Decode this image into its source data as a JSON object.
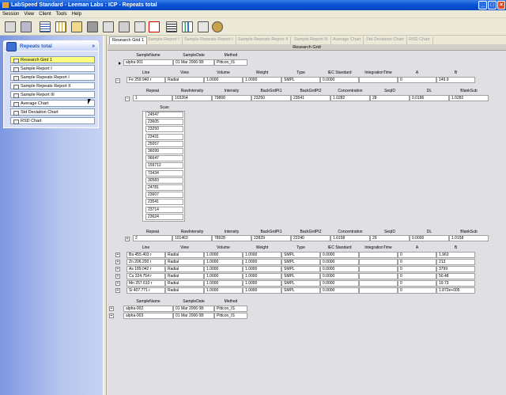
{
  "window": {
    "title": "LabSpeed Standard - Leeman Labs : ICP - Repeats total",
    "min": "_",
    "max": "□",
    "close": "×"
  },
  "menu": [
    "Session",
    "View",
    "Client",
    "Tools",
    "Help"
  ],
  "sidebar": {
    "title": "Repeats total",
    "collapse": "»",
    "items": [
      "Research Grid 1",
      "Sample Report I",
      "Sample Repeats Report I",
      "Sample Repeats Report II",
      "Sample Report III",
      "Average Chart",
      "Std Deviation Chart",
      "RSD Chart"
    ]
  },
  "tabs": [
    "Research Grid 1",
    "Sample Report I",
    "Sample Repeats Report I",
    "Sample Repeats Report II",
    "Sample Report III",
    "Average Chart",
    "Std Deviation Chart",
    "RSD Chart"
  ],
  "grid": {
    "caption": "Research Grid",
    "sample_headers": [
      "SampleName",
      "SampleDate",
      "Method"
    ],
    "sample1": [
      "alpha 001",
      "01 Mar 2006 08:",
      "Pittcon_IS"
    ],
    "line_headers": [
      "Line",
      "View",
      "Volume",
      "Weight",
      "Type",
      "IEC Standard",
      "IntegrationTime",
      "A",
      "B"
    ],
    "line1": [
      "Fe 259.940 r",
      "Radial",
      "1.0000",
      "1.0000",
      "SMPL",
      "0.0000",
      "",
      "0",
      "149.9"
    ],
    "repeat_headers": [
      "Repeat",
      "RawIntensity",
      "Intensity",
      "BackGrdPt1",
      "BackGrdPt2",
      "Concentration",
      "SeqID",
      "DL",
      "BlankSub"
    ],
    "repeat1": [
      "1",
      "103264",
      "79868",
      "23250",
      "23541",
      "1.0282",
      "28",
      "0.0186",
      "1.0282"
    ],
    "scan_header": "Scan",
    "scans": [
      "24547",
      "23605",
      "23250",
      "23431",
      "25057",
      "36099",
      "96647",
      "159712",
      "73434",
      "30583",
      "24781",
      "23607",
      "23541",
      "23714",
      "23624"
    ],
    "repeat2": [
      "2",
      "101463",
      "78928",
      "22829",
      "22240",
      "1.0158",
      "29",
      "0.0000",
      "1.0158"
    ],
    "lines": [
      [
        "Ba 455.403 r",
        "Radial",
        "1.0000",
        "1.0000",
        "SMPL",
        "0.0000",
        "",
        "0",
        "1.963"
      ],
      [
        "Zn 206.200 r",
        "Radial",
        "1.0000",
        "1.0000",
        "SMPL",
        "0.0000",
        "",
        "0",
        "213"
      ],
      [
        "As 189.042 r",
        "Radial",
        "1.0000",
        "1.0000",
        "SMPL",
        "0.0000",
        "",
        "0",
        "3799"
      ],
      [
        "Cu 324.754 r",
        "Radial",
        "1.0000",
        "1.0000",
        "SMPL",
        "0.0000",
        "",
        "0",
        "50.48"
      ],
      [
        "Mn 257.610 r",
        "Radial",
        "1.0000",
        "1.0000",
        "SMPL",
        "0.0000",
        "",
        "0",
        "19.73"
      ],
      [
        "Si 407.771 r",
        "Radial",
        "1.0000",
        "1.0000",
        "SMPL",
        "0.0000",
        "",
        "0",
        "1.872e+005"
      ]
    ],
    "samples": [
      [
        "alpha-002",
        "01 Mar 2006 08:",
        "Pittcon_IS"
      ],
      [
        "alpha-003",
        "01 Mar 2006 08:",
        "Pittcon_IS"
      ]
    ]
  }
}
